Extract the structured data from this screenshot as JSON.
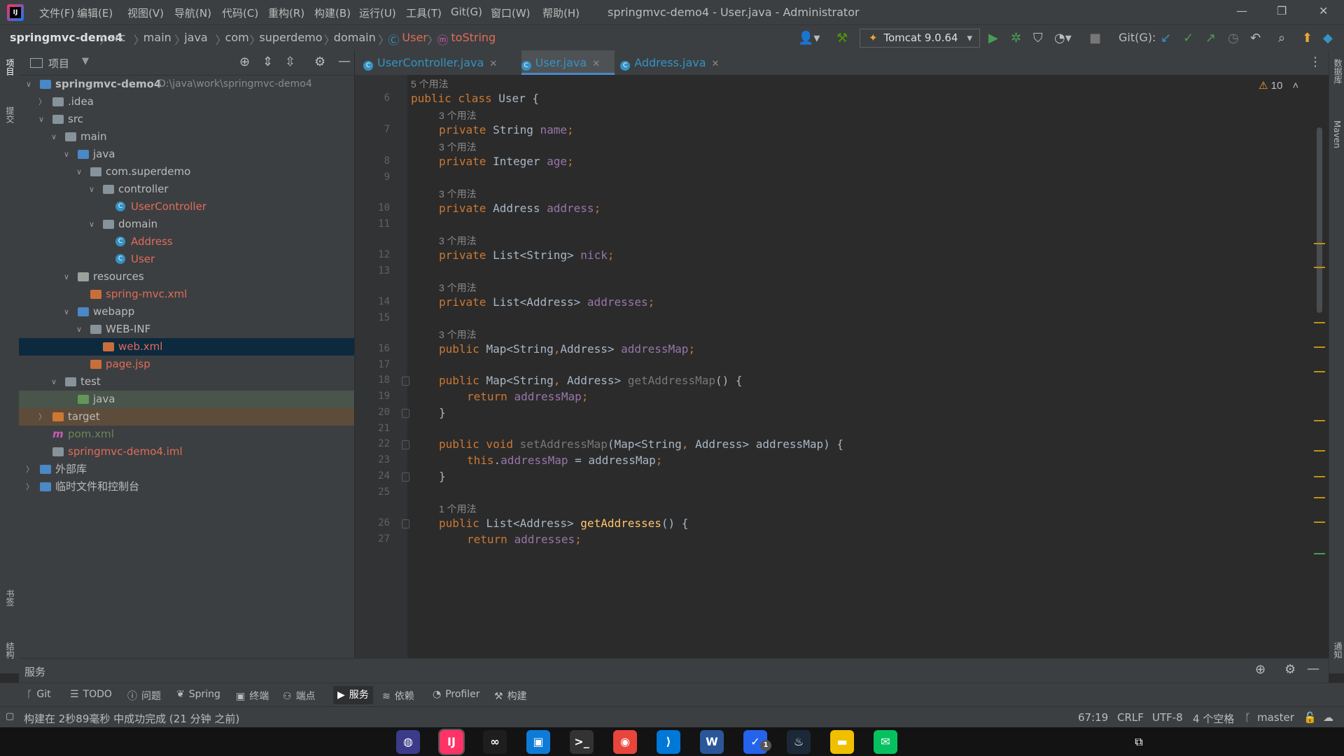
{
  "window": {
    "title": "springmvc-demo4 - User.java - Administrator",
    "menu": [
      "文件(F)",
      "编辑(E)",
      "视图(V)",
      "导航(N)",
      "代码(C)",
      "重构(R)",
      "构建(B)",
      "运行(U)",
      "工具(T)",
      "Git(G)",
      "窗口(W)",
      "帮助(H)"
    ]
  },
  "breadcrumb": {
    "project": "springmvc-demo4",
    "parts": [
      "src",
      "main",
      "java",
      "com",
      "superdemo",
      "domain"
    ],
    "class": "User",
    "method": "toString"
  },
  "toolbar": {
    "run_config": "Tomcat 9.0.64",
    "git_label": "Git(G):"
  },
  "project_panel": {
    "title": "项目",
    "left_strip": [
      "项目",
      "提交",
      "书签",
      "结构"
    ],
    "tree": [
      {
        "label": "springmvc-demo4",
        "path": "D:\\java\\work\\springmvc-demo4",
        "depth": 0,
        "arrow": "open",
        "icon": "module",
        "bold": true
      },
      {
        "label": ".idea",
        "depth": 1,
        "arrow": "closed",
        "icon": "folder"
      },
      {
        "label": "src",
        "depth": 1,
        "arrow": "open",
        "icon": "folder"
      },
      {
        "label": "main",
        "depth": 2,
        "arrow": "open",
        "icon": "folder"
      },
      {
        "label": "java",
        "depth": 3,
        "arrow": "open",
        "icon": "srcfolder"
      },
      {
        "label": "com.superdemo",
        "depth": 4,
        "arrow": "open",
        "icon": "package"
      },
      {
        "label": "controller",
        "depth": 5,
        "arrow": "open",
        "icon": "package"
      },
      {
        "label": "UserController",
        "depth": 6,
        "arrow": "none",
        "icon": "class",
        "color": "#e06c5a"
      },
      {
        "label": "domain",
        "depth": 5,
        "arrow": "open",
        "icon": "package"
      },
      {
        "label": "Address",
        "depth": 6,
        "arrow": "none",
        "icon": "class",
        "color": "#e06c5a"
      },
      {
        "label": "User",
        "depth": 6,
        "arrow": "none",
        "icon": "class",
        "color": "#e06c5a"
      },
      {
        "label": "resources",
        "depth": 3,
        "arrow": "open",
        "icon": "resfolder"
      },
      {
        "label": "spring-mvc.xml",
        "depth": 4,
        "arrow": "none",
        "icon": "xml",
        "color": "#e06c5a"
      },
      {
        "label": "webapp",
        "depth": 3,
        "arrow": "open",
        "icon": "webfolder"
      },
      {
        "label": "WEB-INF",
        "depth": 4,
        "arrow": "open",
        "icon": "folder"
      },
      {
        "label": "web.xml",
        "depth": 5,
        "arrow": "none",
        "icon": "xml",
        "color": "#e06c5a",
        "selected": true
      },
      {
        "label": "page.jsp",
        "depth": 4,
        "arrow": "none",
        "icon": "xml",
        "color": "#e06c5a"
      },
      {
        "label": "test",
        "depth": 2,
        "arrow": "open",
        "icon": "folder"
      },
      {
        "label": "java",
        "depth": 3,
        "arrow": "none",
        "icon": "testfolder",
        "highlight": "test"
      },
      {
        "label": "target",
        "depth": 1,
        "arrow": "closed",
        "icon": "excl",
        "highlight": "excluded"
      },
      {
        "label": "pom.xml",
        "depth": 1,
        "arrow": "none",
        "icon": "maven",
        "color": "#6a8759"
      },
      {
        "label": "springmvc-demo4.iml",
        "depth": 1,
        "arrow": "none",
        "icon": "iml",
        "color": "#e06c5a"
      },
      {
        "label": "外部库",
        "depth": 0,
        "arrow": "closed",
        "icon": "lib"
      },
      {
        "label": "临时文件和控制台",
        "depth": 0,
        "arrow": "closed",
        "icon": "scratch"
      }
    ]
  },
  "tabs": [
    {
      "label": "UserController.java",
      "active": false
    },
    {
      "label": "User.java",
      "active": true
    },
    {
      "label": "Address.java",
      "active": false
    }
  ],
  "editor": {
    "warnings": "10",
    "lines": [
      {
        "type": "hint",
        "text": "5 个用法",
        "indent": 0
      },
      {
        "num": "6",
        "indent": 0,
        "segs": [
          [
            "kw",
            "public class "
          ],
          [
            "pl",
            "User {"
          ]
        ]
      },
      {
        "type": "hint",
        "text": "3 个用法",
        "indent": 1
      },
      {
        "num": "7",
        "indent": 1,
        "segs": [
          [
            "kw",
            "private "
          ],
          [
            "pl",
            "String "
          ],
          [
            "fld",
            "name"
          ],
          [
            "kw",
            ";"
          ]
        ]
      },
      {
        "type": "hint",
        "text": "3 个用法",
        "indent": 1
      },
      {
        "num": "8",
        "indent": 1,
        "segs": [
          [
            "kw",
            "private "
          ],
          [
            "pl",
            "Integer "
          ],
          [
            "fld",
            "age"
          ],
          [
            "kw",
            ";"
          ]
        ]
      },
      {
        "num": "9",
        "segs": []
      },
      {
        "type": "hint",
        "text": "3 个用法",
        "indent": 1
      },
      {
        "num": "10",
        "indent": 1,
        "segs": [
          [
            "kw",
            "private "
          ],
          [
            "pl",
            "Address "
          ],
          [
            "fld",
            "address"
          ],
          [
            "kw",
            ";"
          ]
        ]
      },
      {
        "num": "11",
        "segs": []
      },
      {
        "type": "hint",
        "text": "3 个用法",
        "indent": 1
      },
      {
        "num": "12",
        "indent": 1,
        "segs": [
          [
            "kw",
            "private "
          ],
          [
            "pl",
            "List<String> "
          ],
          [
            "fld",
            "nick"
          ],
          [
            "kw",
            ";"
          ]
        ]
      },
      {
        "num": "13",
        "segs": []
      },
      {
        "type": "hint",
        "text": "3 个用法",
        "indent": 1
      },
      {
        "num": "14",
        "indent": 1,
        "segs": [
          [
            "kw",
            "private "
          ],
          [
            "pl",
            "List<Address> "
          ],
          [
            "fld",
            "addresses"
          ],
          [
            "kw",
            ";"
          ]
        ]
      },
      {
        "num": "15",
        "segs": []
      },
      {
        "type": "hint",
        "text": "3 个用法",
        "indent": 1
      },
      {
        "num": "16",
        "indent": 1,
        "segs": [
          [
            "kw",
            "public "
          ],
          [
            "pl",
            "Map<String"
          ],
          [
            "kw",
            ","
          ],
          [
            "pl",
            "Address> "
          ],
          [
            "fld",
            "addressMap"
          ],
          [
            "kw",
            ";"
          ]
        ]
      },
      {
        "num": "17",
        "segs": []
      },
      {
        "num": "18",
        "indent": 1,
        "fold": true,
        "segs": [
          [
            "kw",
            "public "
          ],
          [
            "pl",
            "Map<String"
          ],
          [
            "kw",
            ", "
          ],
          [
            "pl",
            "Address> "
          ],
          [
            "mtd",
            "getAddressMap"
          ],
          [
            "pl",
            "() {"
          ]
        ]
      },
      {
        "num": "19",
        "indent": 2,
        "segs": [
          [
            "kw",
            "return "
          ],
          [
            "fld",
            "addressMap"
          ],
          [
            "kw",
            ";"
          ]
        ]
      },
      {
        "num": "20",
        "indent": 1,
        "fold": true,
        "segs": [
          [
            "pl",
            "}"
          ]
        ]
      },
      {
        "num": "21",
        "segs": []
      },
      {
        "num": "22",
        "indent": 1,
        "fold": true,
        "segs": [
          [
            "kw",
            "public void "
          ],
          [
            "mtd",
            "setAddressMap"
          ],
          [
            "pl",
            "(Map<String"
          ],
          [
            "kw",
            ", "
          ],
          [
            "pl",
            "Address> addressMap) {"
          ]
        ]
      },
      {
        "num": "23",
        "indent": 2,
        "segs": [
          [
            "kw",
            "this"
          ],
          [
            "pl",
            "."
          ],
          [
            "fld",
            "addressMap "
          ],
          [
            "pl",
            "= addressMap"
          ],
          [
            "kw",
            ";"
          ]
        ]
      },
      {
        "num": "24",
        "indent": 1,
        "fold": true,
        "segs": [
          [
            "pl",
            "}"
          ]
        ]
      },
      {
        "num": "25",
        "segs": []
      },
      {
        "type": "hint",
        "text": "1 个用法",
        "indent": 1
      },
      {
        "num": "26",
        "indent": 1,
        "fold": true,
        "segs": [
          [
            "kw",
            "public "
          ],
          [
            "pl",
            "List<Address> "
          ],
          [
            "mth",
            "getAddresses"
          ],
          [
            "pl",
            "() {"
          ]
        ]
      },
      {
        "num": "27",
        "indent": 2,
        "segs": [
          [
            "kw",
            "return "
          ],
          [
            "fld",
            "addresses"
          ],
          [
            "kw",
            ";"
          ]
        ]
      }
    ]
  },
  "services": {
    "title": "服务"
  },
  "tool_windows": [
    {
      "label": "Git",
      "icon": "git-icon"
    },
    {
      "label": "TODO",
      "icon": "todo-icon"
    },
    {
      "label": "问题",
      "icon": "problems-icon"
    },
    {
      "label": "Spring",
      "icon": "spring-icon"
    },
    {
      "label": "终端",
      "icon": "terminal-icon"
    },
    {
      "label": "端点",
      "icon": "endpoints-icon"
    },
    {
      "label": "服务",
      "icon": "services-icon",
      "active": true
    },
    {
      "label": "依赖",
      "icon": "dependencies-icon"
    },
    {
      "label": "Profiler",
      "icon": "profiler-icon"
    },
    {
      "label": "构建",
      "icon": "build-icon"
    }
  ],
  "status": {
    "message": "构建在 2秒89毫秒 中成功完成 (21 分钟 之前)",
    "position": "67:19",
    "line_sep": "CRLF",
    "encoding": "UTF-8",
    "indent": "4 个空格",
    "branch": "master"
  },
  "right_strip": [
    "数据库",
    "Maven",
    "通知"
  ],
  "taskbar": {
    "apps": [
      "eclipse-icon",
      "intellij-icon",
      "app-icon",
      "app2-icon",
      "terminal-app-icon",
      "chrome-icon",
      "vscode-icon",
      "word-icon",
      "todo-app-icon",
      "steam-icon",
      "explorer-icon",
      "wechat-icon"
    ],
    "badge": "1"
  }
}
